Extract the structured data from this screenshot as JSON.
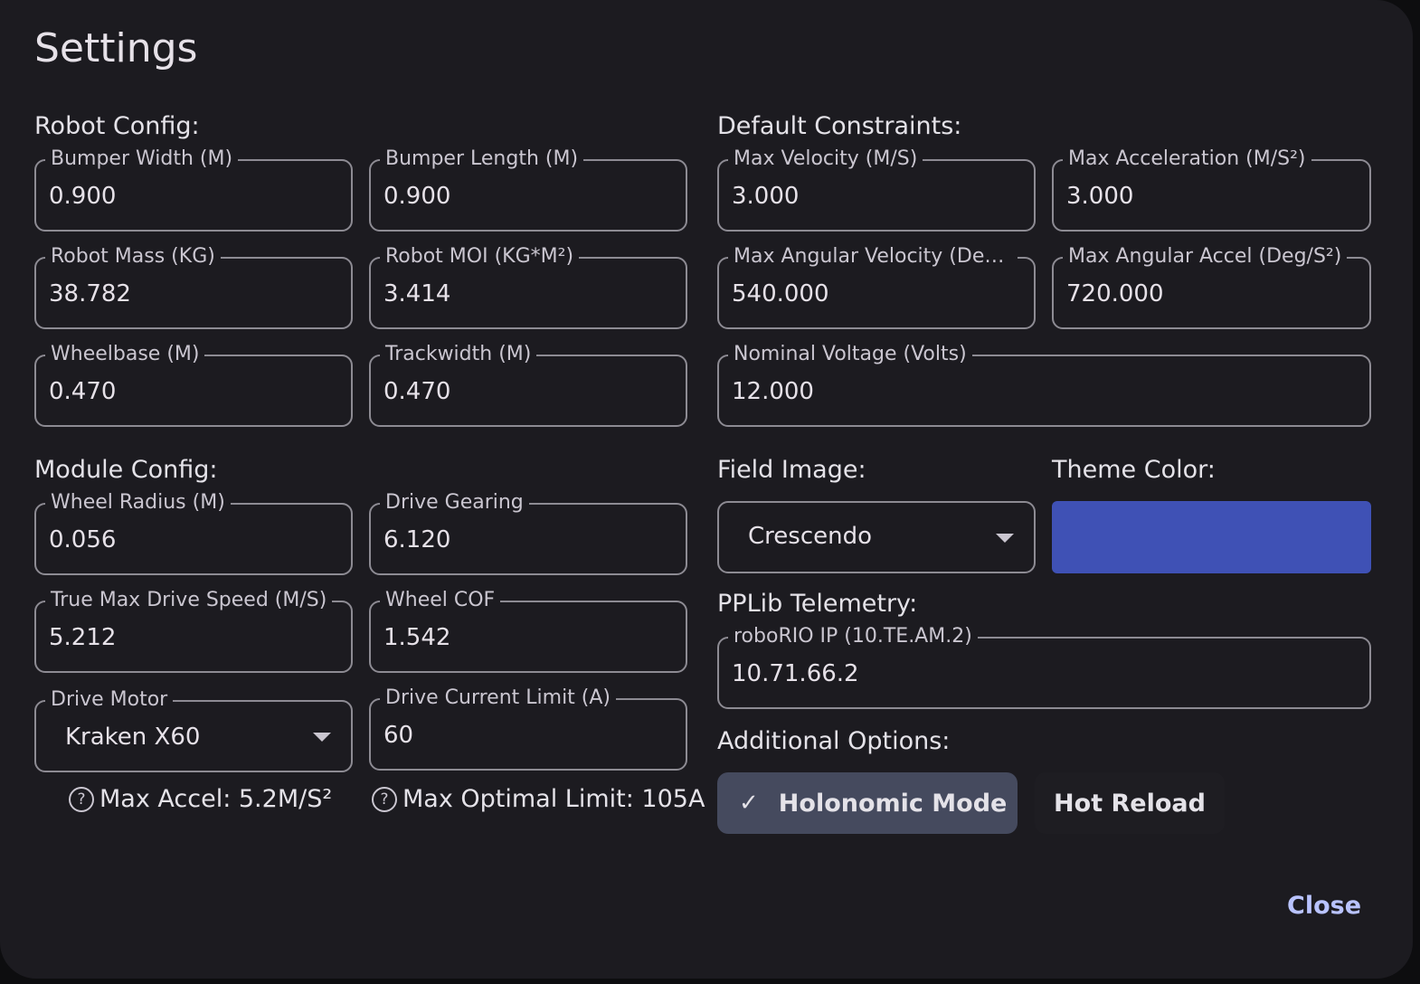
{
  "dialog": {
    "title": "Settings",
    "close_label": "Close"
  },
  "robot_config": {
    "heading": "Robot Config:",
    "bumper_width": {
      "label": "Bumper Width (M)",
      "value": "0.900"
    },
    "bumper_length": {
      "label": "Bumper Length (M)",
      "value": "0.900"
    },
    "robot_mass": {
      "label": "Robot Mass (KG)",
      "value": "38.782"
    },
    "robot_moi": {
      "label": "Robot MOI (KG*M²)",
      "value": "3.414"
    },
    "wheelbase": {
      "label": "Wheelbase (M)",
      "value": "0.470"
    },
    "trackwidth": {
      "label": "Trackwidth (M)",
      "value": "0.470"
    }
  },
  "module_config": {
    "heading": "Module Config:",
    "wheel_radius": {
      "label": "Wheel Radius (M)",
      "value": "0.056"
    },
    "drive_gearing": {
      "label": "Drive Gearing",
      "value": "6.120"
    },
    "true_max_speed": {
      "label": "True Max Drive Speed (M/S)",
      "value": "5.212"
    },
    "wheel_cof": {
      "label": "Wheel COF",
      "value": "1.542"
    },
    "drive_motor": {
      "label": "Drive Motor",
      "value": "Kraken X60"
    },
    "drive_current_limit": {
      "label": "Drive Current Limit (A)",
      "value": "60"
    },
    "hint_accel": "Max Accel: 5.2M/S²",
    "hint_limit": "Max Optimal Limit: 105A"
  },
  "default_constraints": {
    "heading": "Default Constraints:",
    "max_velocity": {
      "label": "Max Velocity (M/S)",
      "value": "3.000"
    },
    "max_acceleration": {
      "label": "Max Acceleration (M/S²)",
      "value": "3.000"
    },
    "max_angular_velocity": {
      "label": "Max Angular Velocity (Deg...",
      "value": "540.000"
    },
    "max_angular_accel": {
      "label": "Max Angular Accel (Deg/S²)",
      "value": "720.000"
    },
    "nominal_voltage": {
      "label": "Nominal Voltage (Volts)",
      "value": "12.000"
    }
  },
  "field_image": {
    "heading": "Field Image:",
    "value": "Crescendo"
  },
  "theme_color": {
    "heading": "Theme Color:",
    "color": "#3f51b5"
  },
  "telemetry": {
    "heading": "PPLib Telemetry:",
    "roborio_ip": {
      "label": "roboRIO IP (10.TE.AM.2)",
      "value": "10.71.66.2"
    }
  },
  "additional_options": {
    "heading": "Additional Options:",
    "holonomic_mode": {
      "label": "Holonomic Mode",
      "selected": true
    },
    "hot_reload": {
      "label": "Hot Reload",
      "selected": false
    }
  },
  "icons": {
    "help": "help-circle-icon",
    "check": "check-icon",
    "dropdown": "chevron-down-icon"
  }
}
